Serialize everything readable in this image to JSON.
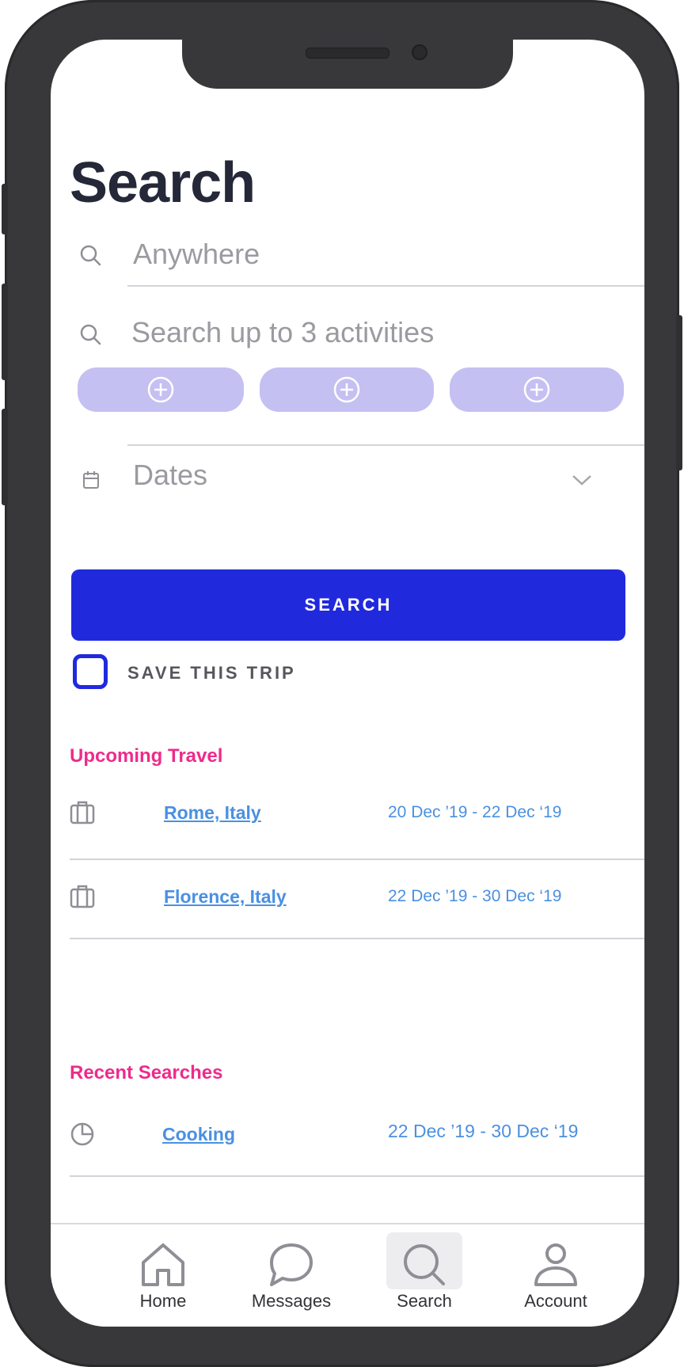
{
  "page": {
    "title": "Search"
  },
  "search_form": {
    "location_placeholder": "Anywhere",
    "activities_placeholder": "Search up to 3 activities",
    "activity_slots": [
      {
        "icon": "plus-circle-icon"
      },
      {
        "icon": "plus-circle-icon"
      },
      {
        "icon": "plus-circle-icon"
      }
    ],
    "dates_placeholder": "Dates",
    "search_button_label": "SEARCH",
    "save_trip_label": "SAVE THIS TRIP",
    "save_trip_checked": false
  },
  "upcoming_travel": {
    "heading": "Upcoming Travel",
    "items": [
      {
        "place": "Rome, Italy",
        "dates": "20 Dec ’19 - 22 Dec ‘19",
        "icon": "luggage-icon"
      },
      {
        "place": "Florence, Italy",
        "dates": "22 Dec ’19 - 30 Dec ‘19",
        "icon": "luggage-icon"
      }
    ]
  },
  "recent_searches": {
    "heading": "Recent Searches",
    "items": [
      {
        "query": "Cooking",
        "dates": "22 Dec ’19 - 30 Dec ‘19",
        "icon": "history-pie-icon"
      }
    ]
  },
  "tabbar": {
    "tabs": [
      {
        "label": "Home",
        "icon": "home-icon"
      },
      {
        "label": "Messages",
        "icon": "chat-bubble-icon"
      },
      {
        "label": "Search",
        "icon": "search-icon",
        "active": true
      },
      {
        "label": "Account",
        "icon": "user-icon"
      }
    ]
  },
  "colors": {
    "accent": "#2129dd",
    "pill": "#c4c0f2",
    "section_heading": "#ee2b8b",
    "link": "#4a90e2",
    "title": "#252838"
  }
}
